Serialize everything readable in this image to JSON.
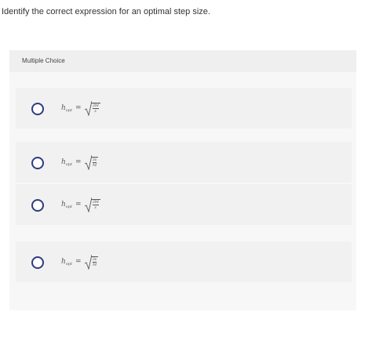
{
  "question": {
    "prompt": "Identify the correct expression for an optimal step size."
  },
  "panel": {
    "title": "Multiple Choice"
  },
  "options": [
    {
      "lhs": "h",
      "sub": "opt",
      "eq": "=",
      "num": "3M",
      "den": "ε"
    },
    {
      "lhs": "h",
      "sub": "opt",
      "eq": "=",
      "num": "3ε",
      "den": "M"
    },
    {
      "lhs": "h",
      "sub": "opt",
      "eq": "=",
      "num": "3M",
      "den": "ε"
    },
    {
      "lhs": "h",
      "sub": "opt",
      "eq": "=",
      "num": "3ε",
      "den": "M"
    }
  ],
  "colors": {
    "radio_border": "#2d3b80",
    "panel_bg": "#f7f7f7",
    "option_bg": "#f1f1f1"
  },
  "icons": {
    "radio": "radio-unselected-icon",
    "root": "cube-root-icon"
  }
}
